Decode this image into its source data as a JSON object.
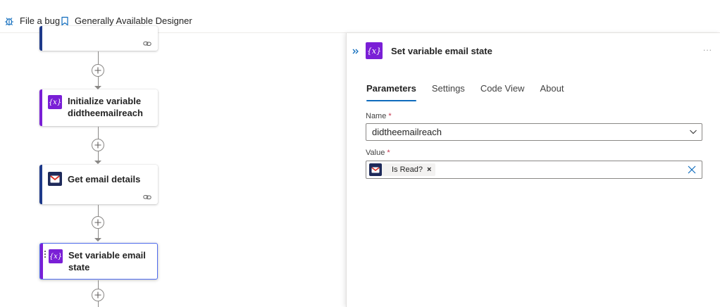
{
  "toolbar": {
    "file_bug_label": "File a bug",
    "designer_label": "Generally Available Designer"
  },
  "flow": {
    "cards": [
      {
        "title": "",
        "icon": "link-icon"
      },
      {
        "title": "Initialize variable didtheemailreach",
        "icon": "variable-icon"
      },
      {
        "title": "Get email details",
        "icon": "gmail-icon"
      },
      {
        "title": "Set variable email state",
        "icon": "variable-icon"
      }
    ],
    "variable_icon_text": "{x}",
    "colors": {
      "variable": "#7a1fd6",
      "gmail": "#1e2a5a",
      "selected": "#4f6bed",
      "accent": "#0f6cbd"
    }
  },
  "panel": {
    "title": "Set variable email state",
    "icon_text": "{x}",
    "more_label": "...",
    "tabs": [
      "Parameters",
      "Settings",
      "Code View",
      "About"
    ],
    "active_tab": "Parameters",
    "name_label": "Name",
    "name_required": "*",
    "name_value": "didtheemailreach",
    "value_label": "Value",
    "value_required": "*",
    "value_token": "Is Read?",
    "token_remove": "×"
  }
}
